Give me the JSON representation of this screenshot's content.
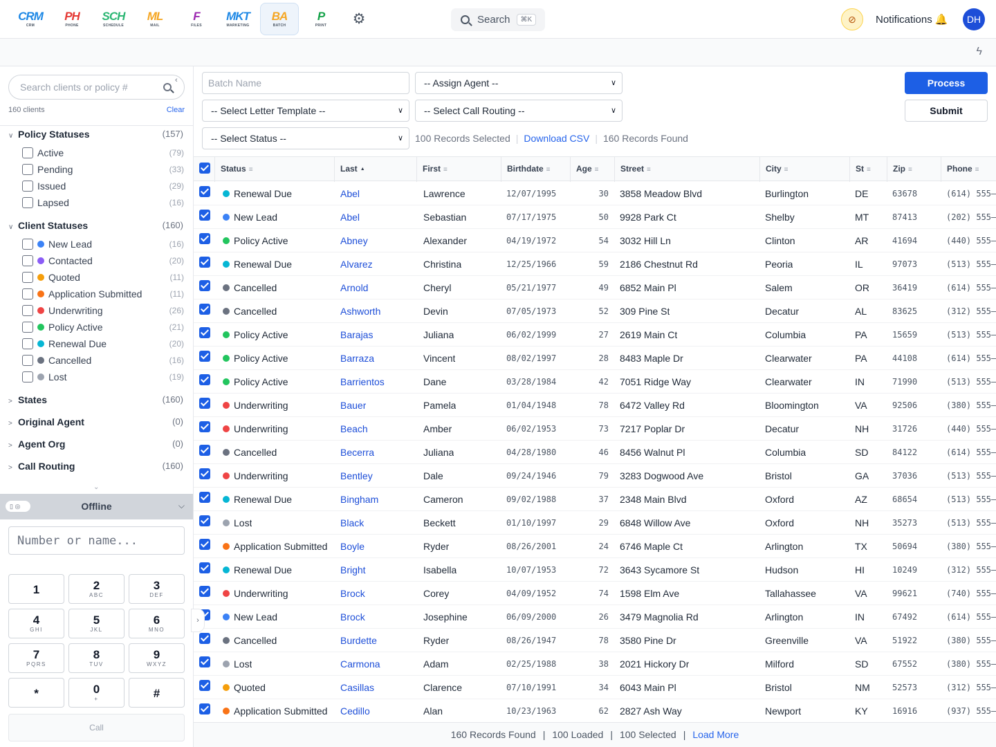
{
  "apps": [
    {
      "logo": "CRM",
      "sub": "CRM",
      "color": "#1e88e5"
    },
    {
      "logo": "PH",
      "sub": "PHONE",
      "color": "#e53935"
    },
    {
      "logo": "SCH",
      "sub": "SCHEDULE",
      "color": "#2bb673"
    },
    {
      "logo": "ML",
      "sub": "MAIL",
      "color": "#f5a623"
    },
    {
      "logo": "F",
      "sub": "FILES",
      "color": "#9c27b0"
    },
    {
      "logo": "MKT",
      "sub": "MARKETING",
      "color": "#1e88e5"
    },
    {
      "logo": "BA",
      "sub": "BATCH",
      "color": "#f5a623"
    },
    {
      "logo": "P",
      "sub": "PRINT",
      "color": "#16a34a"
    }
  ],
  "header": {
    "search_label": "Search",
    "search_kbd": "⌘K",
    "notifications": "Notifications",
    "avatar": "DH"
  },
  "sidebar": {
    "search_placeholder": "Search clients or policy #",
    "client_count": "160 clients",
    "clear": "Clear",
    "policy_statuses": {
      "label": "Policy Statuses",
      "count": "(157)",
      "items": [
        {
          "label": "Active",
          "count": "(79)"
        },
        {
          "label": "Pending",
          "count": "(33)"
        },
        {
          "label": "Issued",
          "count": "(29)"
        },
        {
          "label": "Lapsed",
          "count": "(16)"
        }
      ]
    },
    "client_statuses": {
      "label": "Client Statuses",
      "count": "(160)",
      "items": [
        {
          "label": "New Lead",
          "count": "(16)",
          "color": "#3b82f6"
        },
        {
          "label": "Contacted",
          "count": "(20)",
          "color": "#8b5cf6"
        },
        {
          "label": "Quoted",
          "count": "(11)",
          "color": "#f59e0b"
        },
        {
          "label": "Application Submitted",
          "count": "(11)",
          "color": "#f97316"
        },
        {
          "label": "Underwriting",
          "count": "(26)",
          "color": "#ef4444"
        },
        {
          "label": "Policy Active",
          "count": "(21)",
          "color": "#22c55e"
        },
        {
          "label": "Renewal Due",
          "count": "(20)",
          "color": "#06b6d4"
        },
        {
          "label": "Cancelled",
          "count": "(16)",
          "color": "#6b7280"
        },
        {
          "label": "Lost",
          "count": "(19)",
          "color": "#9ca3af"
        }
      ]
    },
    "collapsed": [
      {
        "label": "States",
        "count": "(160)"
      },
      {
        "label": "Original Agent",
        "count": "(0)"
      },
      {
        "label": "Agent Org",
        "count": "(0)"
      },
      {
        "label": "Call Routing",
        "count": "(160)"
      }
    ]
  },
  "dialer": {
    "status": "Offline",
    "placeholder": "Number or name...",
    "keys": [
      {
        "d": "1",
        "l": ""
      },
      {
        "d": "2",
        "l": "ABC"
      },
      {
        "d": "3",
        "l": "DEF"
      },
      {
        "d": "4",
        "l": "GHI"
      },
      {
        "d": "5",
        "l": "JKL"
      },
      {
        "d": "6",
        "l": "MNO"
      },
      {
        "d": "7",
        "l": "PQRS"
      },
      {
        "d": "8",
        "l": "TUV"
      },
      {
        "d": "9",
        "l": "WXYZ"
      },
      {
        "d": "*",
        "l": ""
      },
      {
        "d": "0",
        "l": "+"
      },
      {
        "d": "#",
        "l": ""
      }
    ],
    "call": "Call"
  },
  "controls": {
    "batch_placeholder": "Batch Name",
    "assign_agent": "-- Assign Agent --",
    "letter_template": "-- Select Letter Template --",
    "call_routing": "-- Select Call Routing --",
    "status": "-- Select Status --",
    "process": "Process",
    "submit": "Submit",
    "records_selected": "100 Records Selected",
    "download_csv": "Download CSV",
    "records_found": "160 Records Found"
  },
  "table": {
    "columns": [
      "Status",
      "Last",
      "First",
      "Birthdate",
      "Age",
      "Street",
      "City",
      "St",
      "Zip",
      "Phone"
    ],
    "status_colors": {
      "New Lead": "#3b82f6",
      "Contacted": "#8b5cf6",
      "Quoted": "#f59e0b",
      "Application Submitted": "#f97316",
      "Underwriting": "#ef4444",
      "Policy Active": "#22c55e",
      "Renewal Due": "#06b6d4",
      "Cancelled": "#6b7280",
      "Lost": "#9ca3af"
    },
    "rows": [
      [
        "Renewal Due",
        "Abel",
        "Lawrence",
        "12/07/1995",
        "30",
        "3858 Meadow Blvd",
        "Burlington",
        "DE",
        "63678",
        "(614) 555–"
      ],
      [
        "New Lead",
        "Abel",
        "Sebastian",
        "07/17/1975",
        "50",
        "9928 Park Ct",
        "Shelby",
        "MT",
        "87413",
        "(202) 555–"
      ],
      [
        "Policy Active",
        "Abney",
        "Alexander",
        "04/19/1972",
        "54",
        "3032 Hill Ln",
        "Clinton",
        "AR",
        "41694",
        "(440) 555–"
      ],
      [
        "Renewal Due",
        "Alvarez",
        "Christina",
        "12/25/1966",
        "59",
        "2186 Chestnut Rd",
        "Peoria",
        "IL",
        "97073",
        "(513) 555–"
      ],
      [
        "Cancelled",
        "Arnold",
        "Cheryl",
        "05/21/1977",
        "49",
        "6852 Main Pl",
        "Salem",
        "OR",
        "36419",
        "(614) 555–"
      ],
      [
        "Cancelled",
        "Ashworth",
        "Devin",
        "07/05/1973",
        "52",
        "309 Pine St",
        "Decatur",
        "AL",
        "83625",
        "(312) 555–"
      ],
      [
        "Policy Active",
        "Barajas",
        "Juliana",
        "06/02/1999",
        "27",
        "2619 Main Ct",
        "Columbia",
        "PA",
        "15659",
        "(513) 555–"
      ],
      [
        "Policy Active",
        "Barraza",
        "Vincent",
        "08/02/1997",
        "28",
        "8483 Maple Dr",
        "Clearwater",
        "PA",
        "44108",
        "(614) 555–"
      ],
      [
        "Policy Active",
        "Barrientos",
        "Dane",
        "03/28/1984",
        "42",
        "7051 Ridge Way",
        "Clearwater",
        "IN",
        "71990",
        "(513) 555–"
      ],
      [
        "Underwriting",
        "Bauer",
        "Pamela",
        "01/04/1948",
        "78",
        "6472 Valley Rd",
        "Bloomington",
        "VA",
        "92506",
        "(380) 555–"
      ],
      [
        "Underwriting",
        "Beach",
        "Amber",
        "06/02/1953",
        "73",
        "7217 Poplar Dr",
        "Decatur",
        "NH",
        "31726",
        "(440) 555–"
      ],
      [
        "Cancelled",
        "Becerra",
        "Juliana",
        "04/28/1980",
        "46",
        "8456 Walnut Pl",
        "Columbia",
        "SD",
        "84122",
        "(614) 555–"
      ],
      [
        "Underwriting",
        "Bentley",
        "Dale",
        "09/24/1946",
        "79",
        "3283 Dogwood Ave",
        "Bristol",
        "GA",
        "37036",
        "(513) 555–"
      ],
      [
        "Renewal Due",
        "Bingham",
        "Cameron",
        "09/02/1988",
        "37",
        "2348 Main Blvd",
        "Oxford",
        "AZ",
        "68654",
        "(513) 555–"
      ],
      [
        "Lost",
        "Black",
        "Beckett",
        "01/10/1997",
        "29",
        "6848 Willow Ave",
        "Oxford",
        "NH",
        "35273",
        "(513) 555–"
      ],
      [
        "Application Submitted",
        "Boyle",
        "Ryder",
        "08/26/2001",
        "24",
        "6746 Maple Ct",
        "Arlington",
        "TX",
        "50694",
        "(380) 555–"
      ],
      [
        "Renewal Due",
        "Bright",
        "Isabella",
        "10/07/1953",
        "72",
        "3643 Sycamore St",
        "Hudson",
        "HI",
        "10249",
        "(312) 555–"
      ],
      [
        "Underwriting",
        "Brock",
        "Corey",
        "04/09/1952",
        "74",
        "1598 Elm Ave",
        "Tallahassee",
        "VA",
        "99621",
        "(740) 555–"
      ],
      [
        "New Lead",
        "Brock",
        "Josephine",
        "06/09/2000",
        "26",
        "3479 Magnolia Rd",
        "Arlington",
        "IN",
        "67492",
        "(614) 555–"
      ],
      [
        "Cancelled",
        "Burdette",
        "Ryder",
        "08/26/1947",
        "78",
        "3580 Pine Dr",
        "Greenville",
        "VA",
        "51922",
        "(380) 555–"
      ],
      [
        "Lost",
        "Carmona",
        "Adam",
        "02/25/1988",
        "38",
        "2021 Hickory Dr",
        "Milford",
        "SD",
        "67552",
        "(380) 555–"
      ],
      [
        "Quoted",
        "Casillas",
        "Clarence",
        "07/10/1991",
        "34",
        "6043 Main Pl",
        "Bristol",
        "NM",
        "52573",
        "(312) 555–"
      ],
      [
        "Application Submitted",
        "Cedillo",
        "Alan",
        "10/23/1963",
        "62",
        "2827 Ash Way",
        "Newport",
        "KY",
        "16916",
        "(937) 555–"
      ]
    ]
  },
  "footer": {
    "found": "160 Records Found",
    "loaded": "100 Loaded",
    "selected": "100 Selected",
    "load_more": "Load More",
    "sep": "|"
  }
}
